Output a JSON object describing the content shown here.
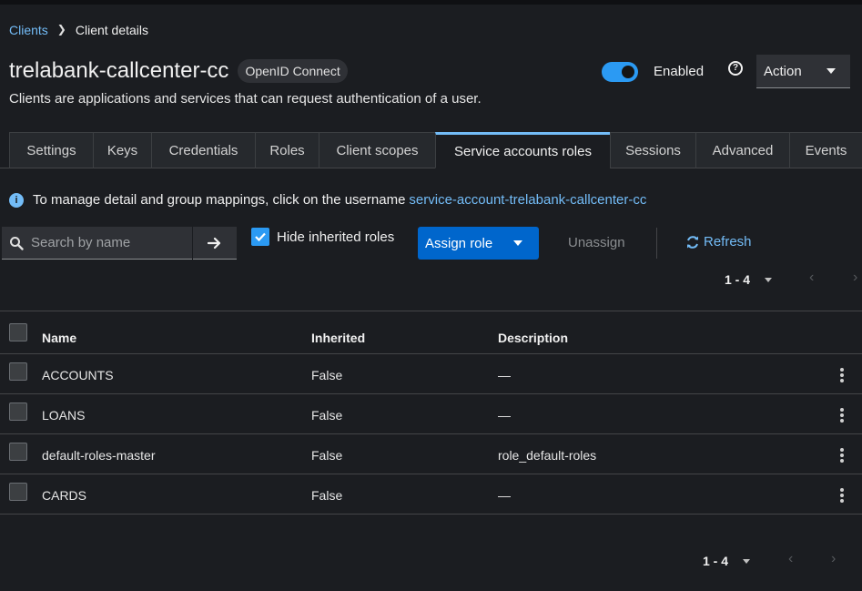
{
  "breadcrumb": {
    "parent": "Clients",
    "current": "Client details"
  },
  "header": {
    "title": "trelabank-callcenter-cc",
    "protocol_badge": "OpenID Connect",
    "subtitle": "Clients are applications and services that can request authentication of a user.",
    "enabled_label": "Enabled",
    "enabled": true,
    "action_label": "Action"
  },
  "tabs": [
    {
      "label": "Settings"
    },
    {
      "label": "Keys"
    },
    {
      "label": "Credentials"
    },
    {
      "label": "Roles"
    },
    {
      "label": "Client scopes"
    },
    {
      "label": "Service accounts roles",
      "active": true
    },
    {
      "label": "Sessions"
    },
    {
      "label": "Advanced"
    },
    {
      "label": "Events"
    }
  ],
  "info": {
    "text": "To manage detail and group mappings, click on the username",
    "link": "service-account-trelabank-callcenter-cc"
  },
  "toolbar": {
    "search_placeholder": "Search by name",
    "hide_inherited_label": "Hide inherited roles",
    "hide_inherited_checked": true,
    "assign_label": "Assign role",
    "unassign_label": "Unassign",
    "refresh_label": "Refresh"
  },
  "pagination": {
    "range": "1 - 4"
  },
  "table": {
    "columns": [
      "Name",
      "Inherited",
      "Description"
    ],
    "rows": [
      {
        "name": "ACCOUNTS",
        "inherited": "False",
        "description": "—"
      },
      {
        "name": "LOANS",
        "inherited": "False",
        "description": "—"
      },
      {
        "name": "default-roles-master",
        "inherited": "False",
        "description": "role_default-roles"
      },
      {
        "name": "CARDS",
        "inherited": "False",
        "description": "—"
      }
    ]
  },
  "colors": {
    "accent": "#73bcf7",
    "primary": "#0066cc",
    "switch": "#2b9af3",
    "background": "#1b1d21"
  }
}
